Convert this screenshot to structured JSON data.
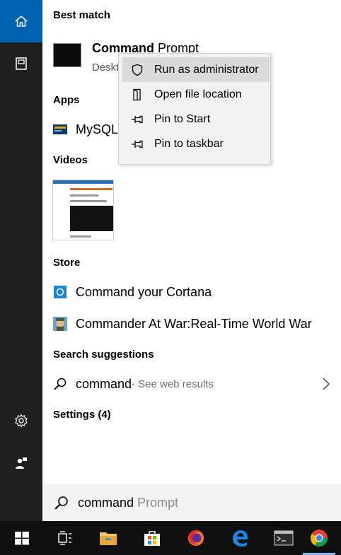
{
  "sections": {
    "best_match": "Best match",
    "apps": "Apps",
    "videos": "Videos",
    "store": "Store",
    "search_suggestions": "Search suggestions",
    "settings": "Settings (4)"
  },
  "best_match": {
    "title_bold": "Command",
    "title_rest": " Prompt",
    "subtitle": "Deskt"
  },
  "apps": [
    {
      "label": "MySQL"
    }
  ],
  "store": [
    {
      "label": "Command your Cortana"
    },
    {
      "label": "Commander At War:Real-Time World War"
    }
  ],
  "suggestion": {
    "query": "command",
    "hint": " - See web results"
  },
  "context_menu": [
    {
      "label": "Run as administrator",
      "icon": "shield-icon"
    },
    {
      "label": "Open file location",
      "icon": "folder-location-icon"
    },
    {
      "label": "Pin to Start",
      "icon": "pin-icon"
    },
    {
      "label": "Pin to taskbar",
      "icon": "pin-icon"
    }
  ],
  "search": {
    "typed": "command",
    "ghost": "Prompt"
  },
  "colors": {
    "accent": "#0063b1",
    "rail": "#1f1f1f",
    "taskbar": "#101010",
    "menu_bg": "#f2f2f2",
    "menu_hover": "#dadada"
  }
}
